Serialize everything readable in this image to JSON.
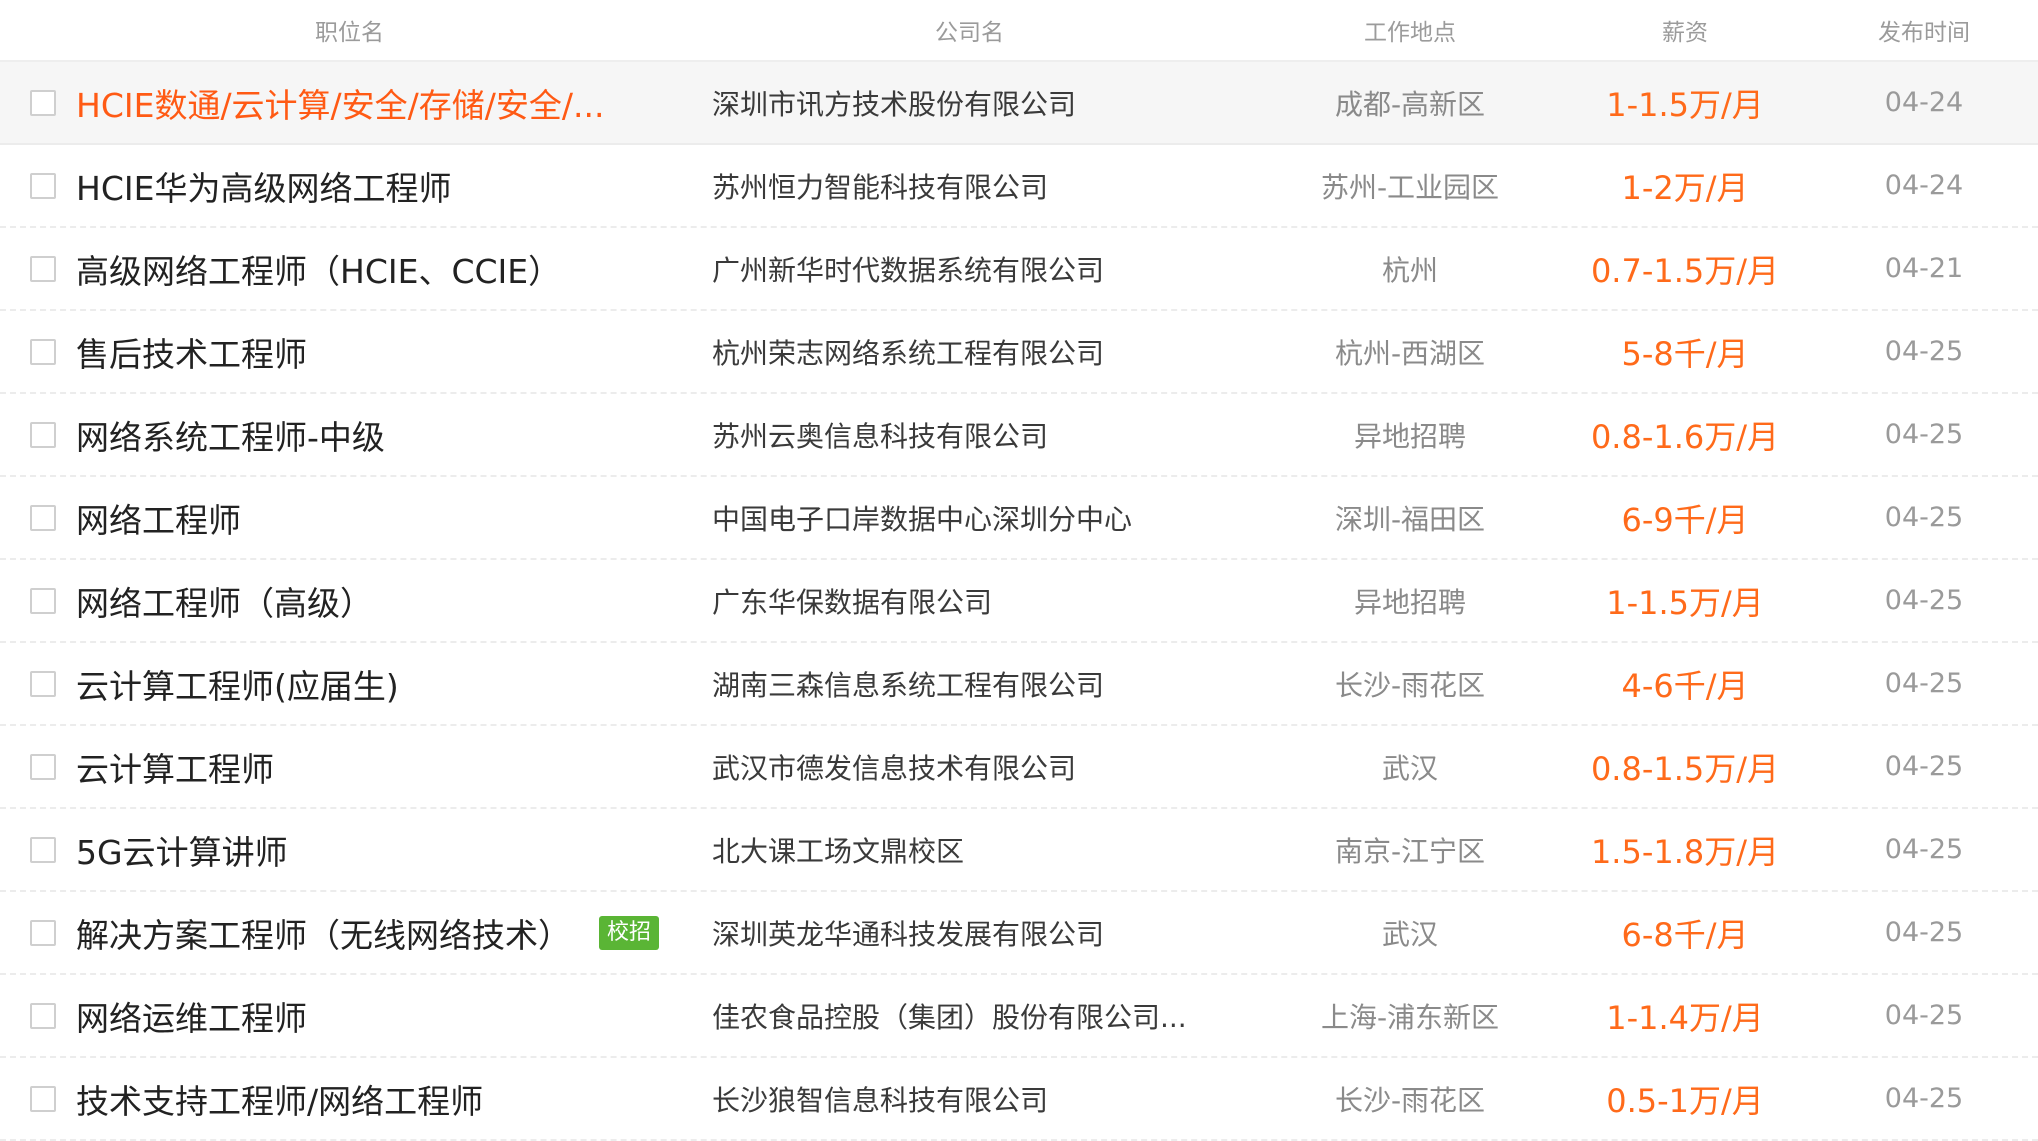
{
  "header": {
    "title": "职位名",
    "company": "公司名",
    "location": "工作地点",
    "salary": "薪资",
    "date": "发布时间"
  },
  "colors": {
    "accent": "#ff6a1a",
    "badge": "#5ab535"
  },
  "rows": [
    {
      "title": "HCIE数通/云计算/安全/存储/安全/...",
      "company": "深圳市讯方技术股份有限公司",
      "location": "成都-高新区",
      "salary": "1-1.5万/月",
      "date": "04-24",
      "badge": ""
    },
    {
      "title": "HCIE华为高级网络工程师",
      "company": "苏州恒力智能科技有限公司",
      "location": "苏州-工业园区",
      "salary": "1-2万/月",
      "date": "04-24",
      "badge": ""
    },
    {
      "title": "高级网络工程师（HCIE、CCIE）",
      "company": "广州新华时代数据系统有限公司",
      "location": "杭州",
      "salary": "0.7-1.5万/月",
      "date": "04-21",
      "badge": ""
    },
    {
      "title": "售后技术工程师",
      "company": "杭州荣志网络系统工程有限公司",
      "location": "杭州-西湖区",
      "salary": "5-8千/月",
      "date": "04-25",
      "badge": ""
    },
    {
      "title": "网络系统工程师-中级",
      "company": "苏州云奥信息科技有限公司",
      "location": "异地招聘",
      "salary": "0.8-1.6万/月",
      "date": "04-25",
      "badge": ""
    },
    {
      "title": "网络工程师",
      "company": "中国电子口岸数据中心深圳分中心",
      "location": "深圳-福田区",
      "salary": "6-9千/月",
      "date": "04-25",
      "badge": ""
    },
    {
      "title": "网络工程师（高级）",
      "company": "广东华保数据有限公司",
      "location": "异地招聘",
      "salary": "1-1.5万/月",
      "date": "04-25",
      "badge": ""
    },
    {
      "title": "云计算工程师(应届生)",
      "company": "湖南三森信息系统工程有限公司",
      "location": "长沙-雨花区",
      "salary": "4-6千/月",
      "date": "04-25",
      "badge": ""
    },
    {
      "title": "云计算工程师",
      "company": "武汉市德发信息技术有限公司",
      "location": "武汉",
      "salary": "0.8-1.5万/月",
      "date": "04-25",
      "badge": ""
    },
    {
      "title": "5G云计算讲师",
      "company": "北大课工场文鼎校区",
      "location": "南京-江宁区",
      "salary": "1.5-1.8万/月",
      "date": "04-25",
      "badge": ""
    },
    {
      "title": "解决方案工程师（无线网络技术）",
      "company": "深圳英龙华通科技发展有限公司",
      "location": "武汉",
      "salary": "6-8千/月",
      "date": "04-25",
      "badge": "校招"
    },
    {
      "title": "网络运维工程师",
      "company": "佳农食品控股（集团）股份有限公司...",
      "location": "上海-浦东新区",
      "salary": "1-1.4万/月",
      "date": "04-25",
      "badge": ""
    },
    {
      "title": "技术支持工程师/网络工程师",
      "company": "长沙狼智信息科技有限公司",
      "location": "长沙-雨花区",
      "salary": "0.5-1万/月",
      "date": "04-25",
      "badge": ""
    }
  ]
}
